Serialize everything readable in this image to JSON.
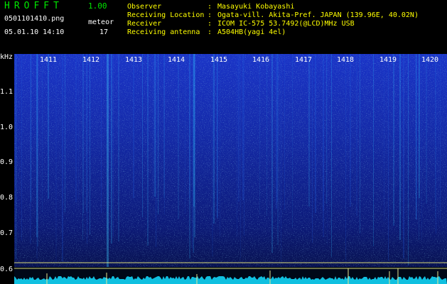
{
  "header": {
    "app_title": "HROFFT",
    "app_version": "1.00",
    "filename": "0501101410.png",
    "datetime": "05.01.10 14:10",
    "meteor_label": "meteor",
    "meteor_count": "17"
  },
  "station_info": [
    {
      "label": "Observer",
      "sep": ":",
      "value": "Masayuki Kobayashi"
    },
    {
      "label": "Receiving Location",
      "sep": ":",
      "value": "Ogata-vill. Akita-Pref. JAPAN (139.96E, 40.02N)"
    },
    {
      "label": "Receiver",
      "sep": ":",
      "value": "ICOM IC-575 53.7492(@LCD)MHz USB"
    },
    {
      "label": "Receiving antenna",
      "sep": ":",
      "value": "A504HB(yagi 4el)"
    }
  ],
  "axis": {
    "y_unit": "kHz",
    "y_ticks": [
      "1.1",
      "1.0",
      "0.9",
      "0.8",
      "0.7",
      "0.6"
    ],
    "x_ticks": [
      "1411",
      "1412",
      "1413",
      "1414",
      "1415",
      "1416",
      "1417",
      "1418",
      "1419",
      "1420"
    ]
  },
  "colors": {
    "title_green": "#00e600",
    "info_yellow": "#ffff00",
    "spectrum_dark": "#00001a",
    "spectrum_blue": "#1020a0",
    "spectrum_cyan": "#30c0ff"
  }
}
